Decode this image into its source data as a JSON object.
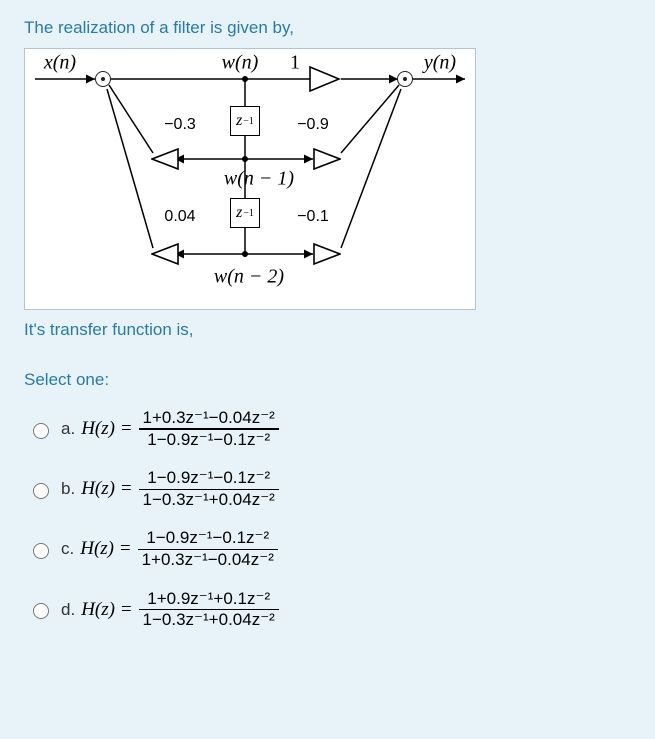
{
  "question": {
    "prompt": "The realization of a filter is given by,",
    "subprompt": "It's transfer function is,",
    "select_label": "Select one:"
  },
  "figure": {
    "x_label": "x(n)",
    "w_label": "w(n)",
    "gain_label": "1",
    "y_label": "y(n)",
    "z1": "z",
    "z1_exp": "−1",
    "fb1": "−0.3",
    "ff1": "−0.9",
    "w1_label": "w(n − 1)",
    "z2": "z",
    "z2_exp": "−1",
    "fb2": "0.04",
    "ff2": "−0.1",
    "w2_label": "w(n − 2)"
  },
  "options": {
    "a": {
      "label": "a.",
      "lead": "H(z) =",
      "num": "1+0.3z⁻¹−0.04z⁻²",
      "den": "1−0.9z⁻¹−0.1z⁻²"
    },
    "b": {
      "label": "b.",
      "lead": "H(z) =",
      "num": "1−0.9z⁻¹−0.1z⁻²",
      "den": "1−0.3z⁻¹+0.04z⁻²"
    },
    "c": {
      "label": "c.",
      "lead": "H(z) =",
      "num": "1−0.9z⁻¹−0.1z⁻²",
      "den": "1+0.3z⁻¹−0.04z⁻²"
    },
    "d": {
      "label": "d.",
      "lead": "H(z) =",
      "num": "1+0.9z⁻¹+0.1z⁻²",
      "den": "1−0.3z⁻¹+0.04z⁻²"
    }
  }
}
